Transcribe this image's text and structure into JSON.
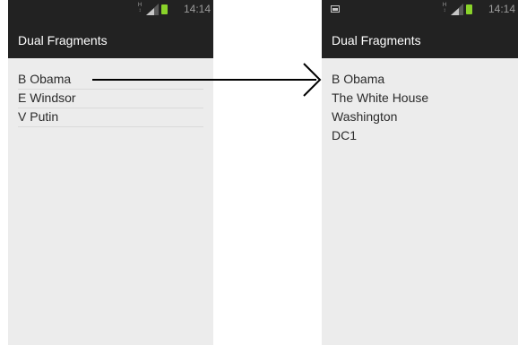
{
  "left_screen": {
    "status_bar": {
      "time": "14:14",
      "network_label": "H"
    },
    "action_bar": {
      "title": "Dual Fragments"
    },
    "list_items": [
      "B Obama",
      "E Windsor",
      "V Putin"
    ]
  },
  "right_screen": {
    "status_bar": {
      "time": "14:14",
      "network_label": "H"
    },
    "action_bar": {
      "title": "Dual Fragments"
    },
    "details": [
      "B Obama",
      "The White House",
      "Washington",
      "DC1"
    ]
  },
  "colors": {
    "bar_background": "#222222",
    "content_background": "#ececec",
    "battery": "#8ad32a",
    "arrow": "#000000"
  },
  "icons": [
    "network-type-icon",
    "signal-icon",
    "battery-icon",
    "notification-image-icon",
    "arrow-icon"
  ]
}
